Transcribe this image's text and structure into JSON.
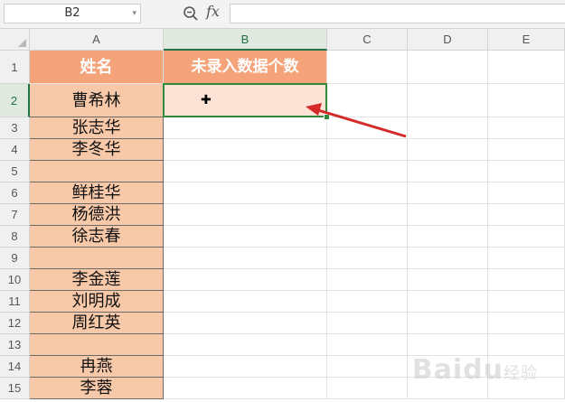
{
  "formula_bar": {
    "name_box": "B2",
    "fx_label": "fx",
    "formula_value": ""
  },
  "columns": [
    "A",
    "B",
    "C",
    "D",
    "E"
  ],
  "rows": [
    "1",
    "2",
    "3",
    "4",
    "5",
    "6",
    "7",
    "8",
    "9",
    "10",
    "11",
    "12",
    "13",
    "14",
    "15"
  ],
  "sheet": {
    "header_a": "姓名",
    "header_b": "未录入数据个数",
    "names": [
      "曹希林",
      "张志华",
      "李冬华",
      "",
      "鲜桂华",
      "杨德洪",
      "徐志春",
      "",
      "李金莲",
      "刘明成",
      "周红英",
      "",
      "冉燕",
      "李蓉"
    ]
  },
  "colors": {
    "header_fill": "#f4a37a",
    "name_fill": "#f7c9a9",
    "selection": "#2f8a3c",
    "arrow": "#d42a2a"
  },
  "watermark": {
    "brand": "Baidu",
    "suffix": "经验"
  }
}
